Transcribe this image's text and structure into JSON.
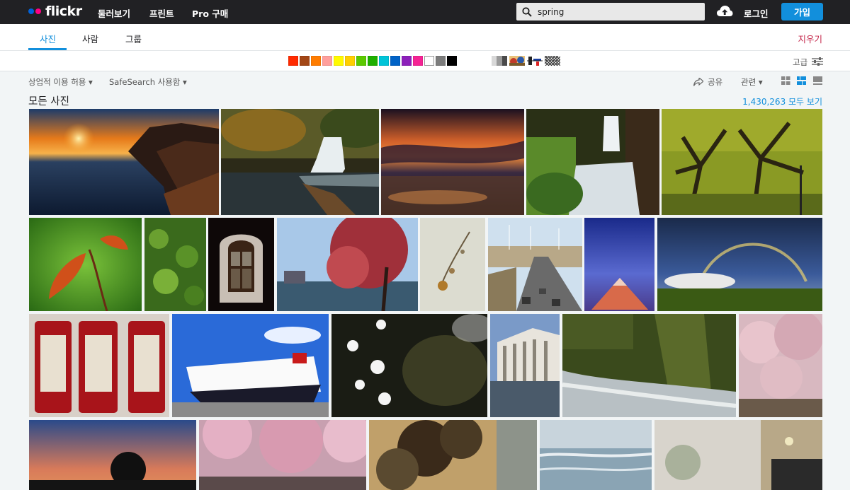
{
  "header": {
    "logo_text": "flickr",
    "nav": [
      "둘러보기",
      "프린트",
      "Pro 구매"
    ],
    "search": {
      "value": "spring",
      "icon": "search-icon"
    },
    "upload_icon": "cloud-upload-icon",
    "login_label": "로그인",
    "signup_label": "가입",
    "colors": {
      "bar": "#212124",
      "accent": "#128fdc",
      "logo_blue": "#0063dc",
      "logo_pink": "#ff0084"
    }
  },
  "tabs": {
    "items": [
      "사진",
      "사람",
      "그룹"
    ],
    "active": "사진",
    "clear_label": "지우기"
  },
  "color_filter": {
    "swatches": [
      "#ff2a00",
      "#a24615",
      "#ff7c00",
      "#ff9f9c",
      "#fffa00",
      "#ffcf00",
      "#5ac900",
      "#1eaf00",
      "#00c4d8",
      "#0062c6",
      "#8c20ba",
      "#f52394",
      "#ffffff",
      "#7c7c7c",
      "#000000"
    ],
    "advanced_label": "고급"
  },
  "filters": {
    "license_label": "상업적 이용 허용",
    "safesearch_label": "SafeSearch 사용함",
    "share_label": "공유",
    "sort_label": "관련"
  },
  "results": {
    "title": "모든 사진",
    "count_link": "1,430,263 모두 보기"
  }
}
